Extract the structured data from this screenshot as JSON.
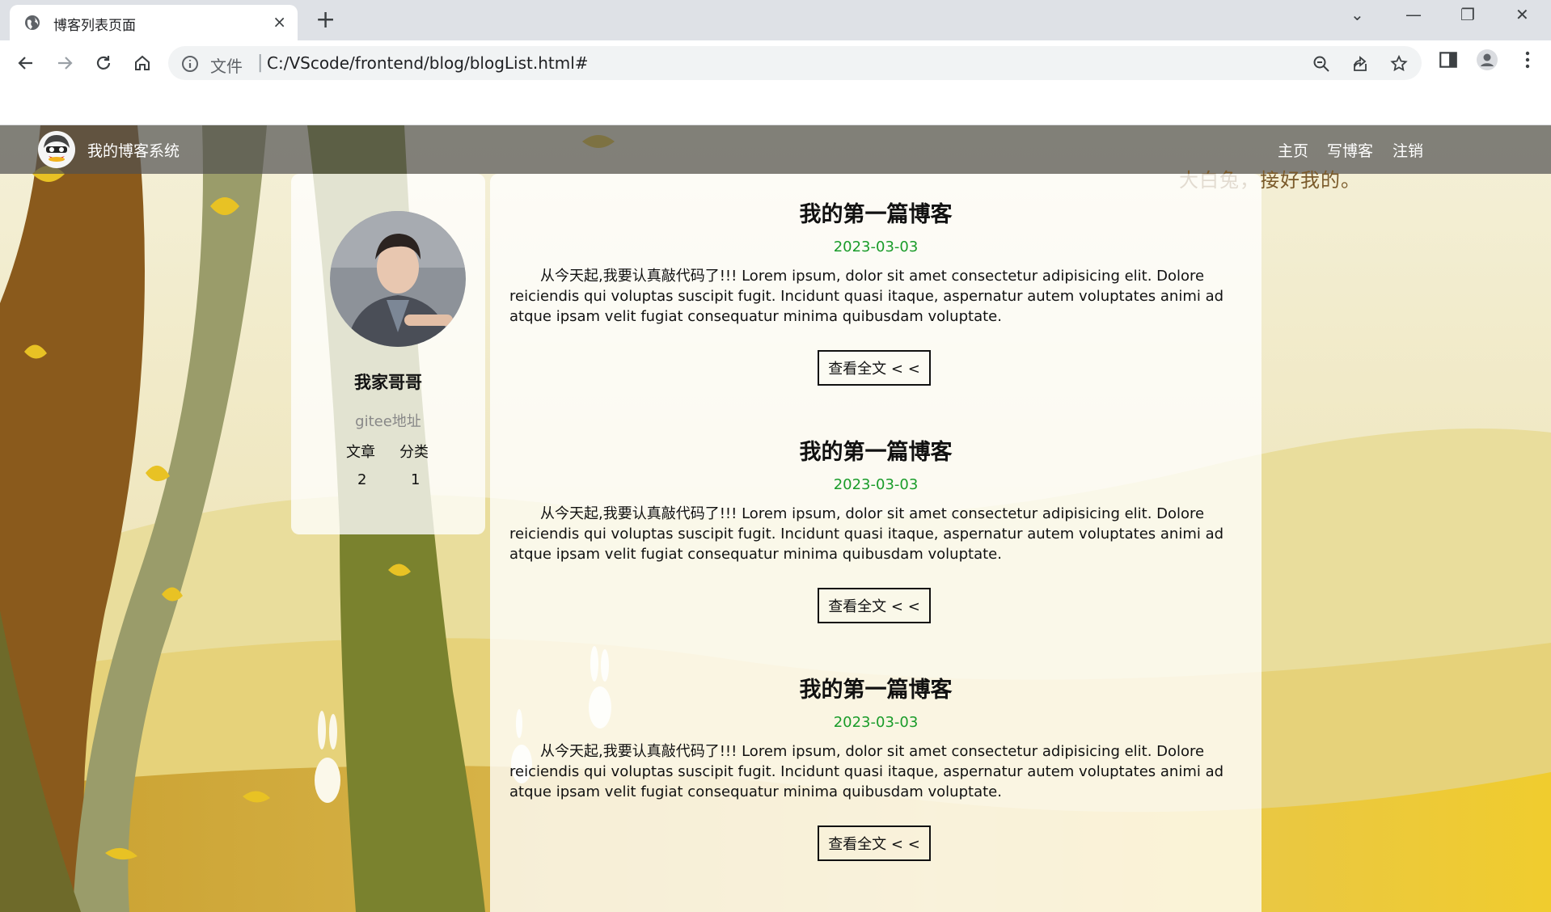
{
  "browser": {
    "tab_title": "博客列表页面",
    "tab_close": "×",
    "new_tab": "+",
    "url_label": "文件",
    "url_separator": "|",
    "url": "C:/VScode/frontend/blog/blogList.html#",
    "window_controls": {
      "dropdown": "⌄",
      "minimize": "—",
      "restore": "❐",
      "close": "✕"
    }
  },
  "navbar": {
    "brand": "我的博客系统",
    "links": [
      "主页",
      "写博客",
      "注销"
    ]
  },
  "user": {
    "name": "我家哥哥",
    "gitee": "gitee地址",
    "stats_labels": [
      "文章",
      "分类"
    ],
    "stats_values": [
      "2",
      "1"
    ]
  },
  "background_text": "大白兔，接好我的。",
  "blogs": [
    {
      "title": "我的第一篇博客",
      "date": "2023-03-03",
      "desc": "从今天起,我要认真敲代码了!!! Lorem ipsum, dolor sit amet consectetur adipisicing elit. Dolore reiciendis qui voluptas suscipit fugit. Incidunt quasi itaque, aspernatur autem voluptates animi ad atque ipsam velit fugiat consequatur minima quibusdam voluptate.",
      "more": "查看全文 < <"
    },
    {
      "title": "我的第一篇博客",
      "date": "2023-03-03",
      "desc": "从今天起,我要认真敲代码了!!! Lorem ipsum, dolor sit amet consectetur adipisicing elit. Dolore reiciendis qui voluptas suscipit fugit. Incidunt quasi itaque, aspernatur autem voluptates animi ad atque ipsam velit fugiat consequatur minima quibusdam voluptate.",
      "more": "查看全文 < <"
    },
    {
      "title": "我的第一篇博客",
      "date": "2023-03-03",
      "desc": "从今天起,我要认真敲代码了!!! Lorem ipsum, dolor sit amet consectetur adipisicing elit. Dolore reiciendis qui voluptas suscipit fugit. Incidunt quasi itaque, aspernatur autem voluptates animi ad atque ipsam velit fugiat consequatur minima quibusdam voluptate.",
      "more": "查看全文 < <"
    }
  ],
  "colors": {
    "date_green": "#1a9c2a",
    "navbar_bg": "#505050",
    "chrome_tabstrip": "#dee1e6"
  }
}
